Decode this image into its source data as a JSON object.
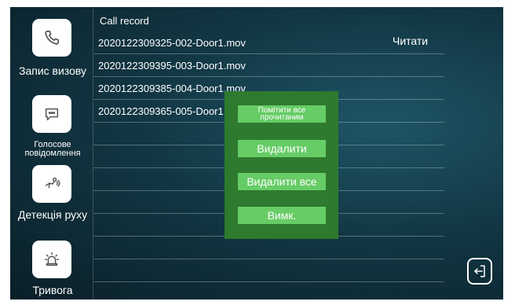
{
  "sidebar": {
    "items": [
      {
        "label": "Запис визову",
        "icon": "phone-icon"
      },
      {
        "label": "Голосове повідомлення",
        "icon": "voice-message-icon"
      },
      {
        "label": "Детекція руху",
        "icon": "motion-detection-icon"
      },
      {
        "label": "Тривога",
        "icon": "alarm-icon"
      }
    ]
  },
  "list": {
    "header": "Call record",
    "read_label": "Читати",
    "rows": [
      "2020122309325-002-Door1.mov",
      "2020122309395-003-Door1.mov",
      "2020122309385-004-Door1.mov",
      "2020122309365-005-Door1.mov"
    ]
  },
  "popup": {
    "mark_all_read_line1": "Помітити все",
    "mark_all_read_line2": "прочитаним",
    "delete": "Видалити",
    "delete_all": "Видалити все",
    "off": "Вимк."
  },
  "exit": {
    "icon": "exit-icon"
  },
  "colors": {
    "popup_bg": "#2e7a2e",
    "popup_button": "#66cc66",
    "background": "#123744"
  }
}
